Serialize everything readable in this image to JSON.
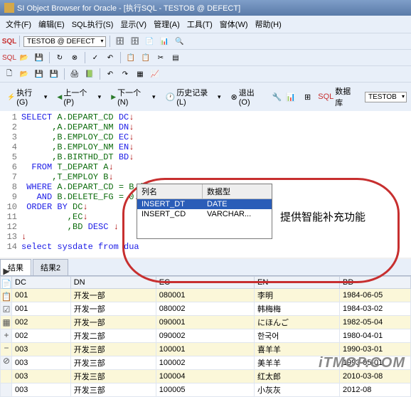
{
  "window": {
    "title": "SI Object Browser for Oracle - [执行SQL  - TESTOB @ DEFECT]"
  },
  "menu": {
    "file": "文件(F)",
    "edit": "编辑(E)",
    "sql": "SQL执行(S)",
    "display": "显示(V)",
    "manage": "管理(A)",
    "tools": "工具(T)",
    "window": "窗体(W)",
    "help": "帮助(H)"
  },
  "conn": {
    "label": "TESTOB @ DEFECT"
  },
  "nav": {
    "exec": "执行(G)",
    "prev": "上一个(P)",
    "next": "下一个(N)",
    "history": "历史记录(L)",
    "exit": "退出(O)",
    "db": "数据库",
    "schema": "TESTOB"
  },
  "code": {
    "l1a": "SELECT",
    "l1b": " A.DEPART_CD ",
    "l1c": "DC",
    "l1d": "↓",
    "l2a": "      ,A.DEPART_NM ",
    "l2b": "DN",
    "l2c": "↓",
    "l3a": "      ,B.EMPLOY_CD ",
    "l3b": "EC",
    "l3c": "↓",
    "l4a": "      ,B.EMPLOY_NM ",
    "l4b": "EN",
    "l4c": "↓",
    "l5a": "      ,B.BIRTHD_DT ",
    "l5b": "BD",
    "l5c": "↓",
    "l6a": "  FROM",
    "l6b": " T_DEPART A",
    "l6c": "↓",
    "l7a": "      ,T_EMPLOY B",
    "l7b": "↓",
    "l8a": " WHERE",
    "l8b": " A.DEPART_CD = B.i",
    "l8c": "↓",
    "l9a": "   AND",
    "l9b": " B.DELETE_FG = 0",
    "l9c": "↓",
    "l10a": " ORDER BY",
    "l10b": " DC",
    "l10c": "↓",
    "l11a": "         ,EC",
    "l11b": "↓",
    "l12a": "         ,BD ",
    "l12b": "DESC",
    "l12c": " ↓",
    "l13": "↓",
    "l14": "select sysdate from dua"
  },
  "popup": {
    "col_name": "列名",
    "col_type": "数据型",
    "r1_name": "INSERT_DT",
    "r1_type": "DATE",
    "r2_name": "INSERT_CD",
    "r2_type": "VARCHAR..."
  },
  "anno": {
    "text": "提供智能补充功能"
  },
  "tabs": {
    "t1": "结果",
    "t2": "结果2"
  },
  "grid": {
    "headers": {
      "dc": "DC",
      "dn": "DN",
      "ec": "EC",
      "en": "EN",
      "bd": "BD"
    },
    "rows": [
      {
        "dc": "001",
        "dn": "开发一部",
        "ec": "080001",
        "en": "李明",
        "bd": "1984-06-05"
      },
      {
        "dc": "001",
        "dn": "开发一部",
        "ec": "080002",
        "en": "韩梅梅",
        "bd": "1984-03-02"
      },
      {
        "dc": "002",
        "dn": "开发一部",
        "ec": "090001",
        "en": "にほんご",
        "bd": "1982-05-04"
      },
      {
        "dc": "002",
        "dn": "开发二部",
        "ec": "090002",
        "en": "한국어",
        "bd": "1980-04-01"
      },
      {
        "dc": "003",
        "dn": "开发三部",
        "ec": "100001",
        "en": "喜羊羊",
        "bd": "1990-03-01"
      },
      {
        "dc": "003",
        "dn": "开发三部",
        "ec": "100002",
        "en": "美羊羊",
        "bd": "1993-05-01"
      },
      {
        "dc": "003",
        "dn": "开发三部",
        "ec": "100004",
        "en": "红太郎",
        "bd": "2010-03-08"
      },
      {
        "dc": "003",
        "dn": "开发三部",
        "ec": "100005",
        "en": "小灰灰",
        "bd": "2012-08"
      }
    ]
  },
  "watermark": "iTMOP.COM",
  "colors": {
    "accent": "#2a5db8",
    "ring": "#c72f2f",
    "kw": "#1a1ae6",
    "ident": "#0c6b0c"
  }
}
